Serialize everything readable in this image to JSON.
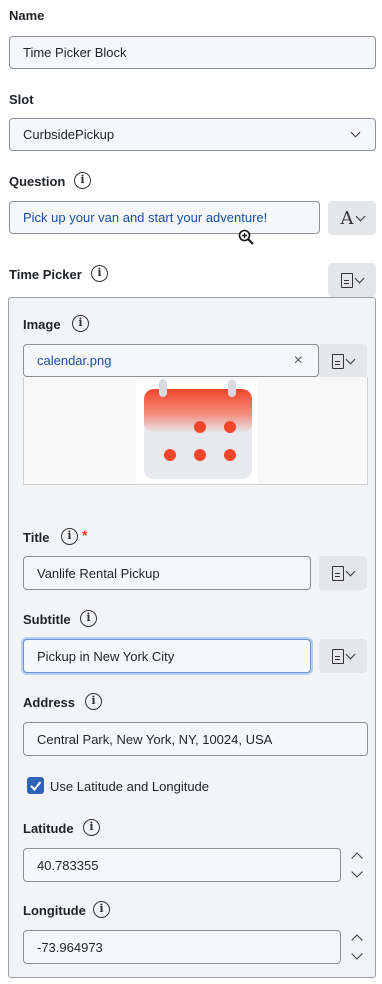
{
  "name": {
    "label": "Name",
    "value": "Time Picker Block"
  },
  "slot": {
    "label": "Slot",
    "value": "CurbsidePickup"
  },
  "question": {
    "label": "Question",
    "value": "Pick up your van and start your adventure!"
  },
  "time_picker": {
    "label": "Time Picker",
    "image": {
      "label": "Image",
      "value": "calendar.png",
      "clear_glyph": "×"
    },
    "title": {
      "label": "Title",
      "required_mark": "*",
      "value": "Vanlife Rental Pickup"
    },
    "subtitle": {
      "label": "Subtitle",
      "value": "Pickup in New York City"
    },
    "address": {
      "label": "Address",
      "value": "Central Park, New York, NY, 10024, USA"
    },
    "use_lat_long": {
      "label": "Use Latitude and Longitude",
      "checked": true
    },
    "latitude": {
      "label": "Latitude",
      "value": "40.783355"
    },
    "longitude": {
      "label": "Longitude",
      "value": "-73.964973"
    }
  },
  "icons": {
    "info": "i",
    "text_format": "A"
  },
  "colors": {
    "accent": "#2f63b8",
    "calendar_red": "#f0472c",
    "required": "#d93b2b"
  }
}
